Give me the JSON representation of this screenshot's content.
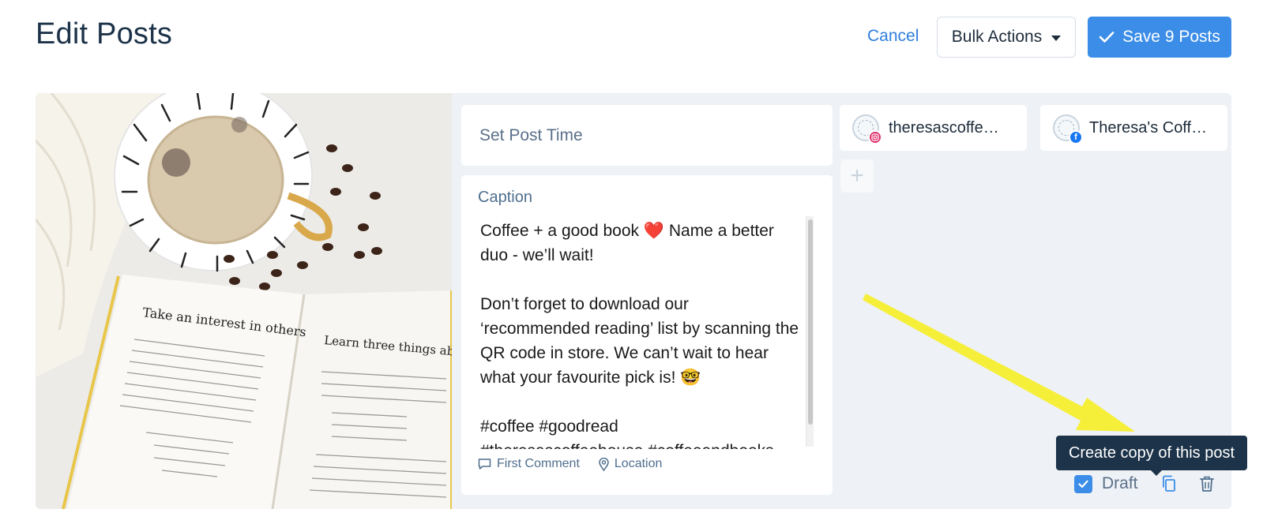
{
  "header": {
    "title": "Edit Posts",
    "cancel_label": "Cancel",
    "bulk_actions_label": "Bulk Actions",
    "save_label": "Save 9 Posts"
  },
  "post": {
    "set_time_label": "Set Post Time",
    "caption_label": "Caption",
    "caption_text": "Coffee + a good book ❤️ Name a better duo - we’ll wait!\n\nDon’t forget to download our ‘recommended reading’ list by scanning the QR code in store. We can’t wait to hear what your favourite pick is! 🤓\n\n#coffee #goodread\n#theresascoffeehouse #coffeeandbooks",
    "first_comment_label": "First Comment",
    "location_label": "Location",
    "accounts": [
      {
        "name": "theresascoffe…",
        "network": "instagram-icon"
      },
      {
        "name": "Theresa's Coff…",
        "network": "facebook-icon"
      }
    ],
    "add_label": "+",
    "draft_label": "Draft",
    "draft_checked": true,
    "tooltip_text": "Create copy of this post"
  },
  "colors": {
    "accent": "#3b8de8",
    "link": "#2f7fdc",
    "tooltip_bg": "#1d3349",
    "arrow": "#f6ef3a",
    "instagram": "#e1306c",
    "facebook": "#1877f2"
  }
}
